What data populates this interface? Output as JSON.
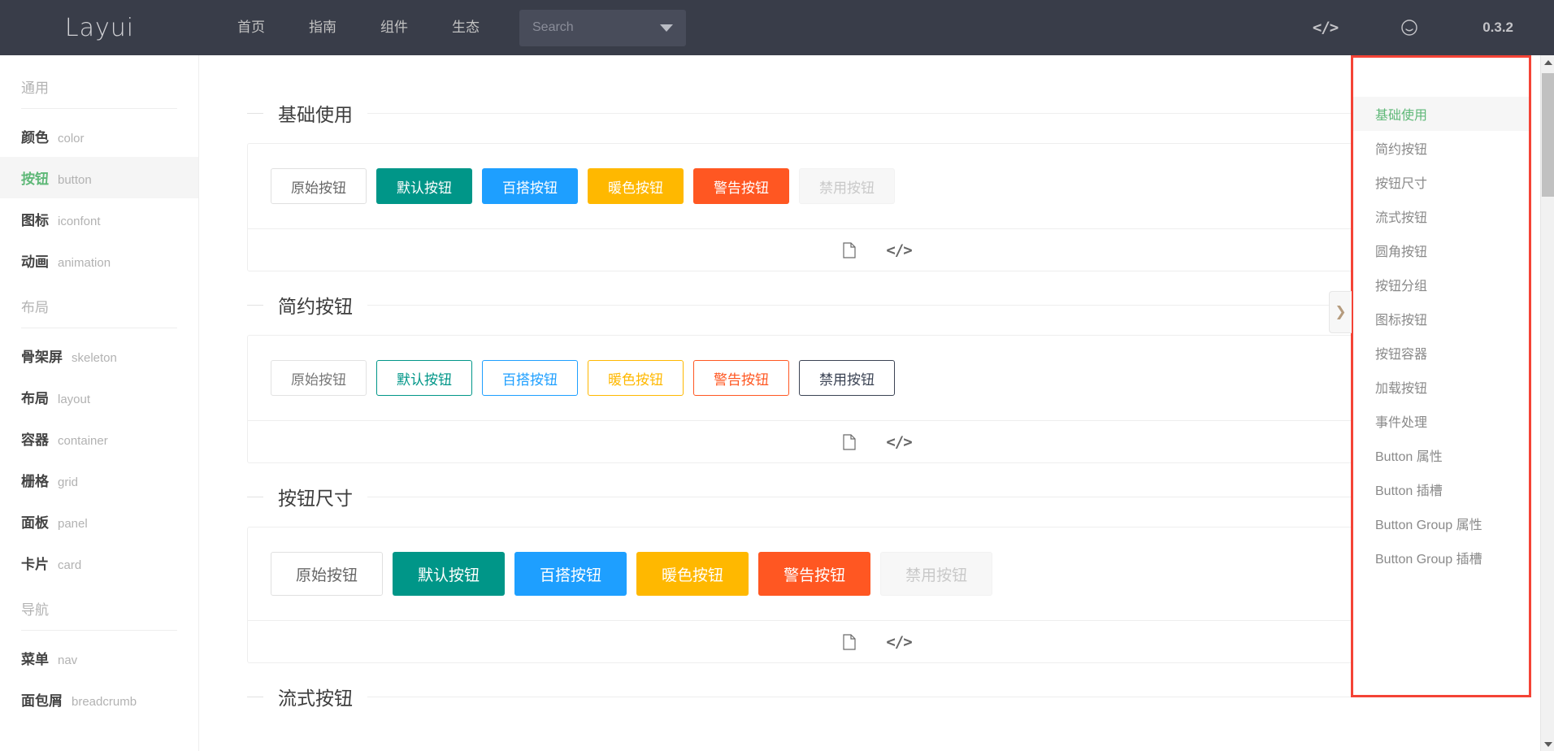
{
  "header": {
    "logo": "Layui",
    "nav": [
      {
        "label": "首页"
      },
      {
        "label": "指南"
      },
      {
        "label": "组件"
      },
      {
        "label": "生态"
      }
    ],
    "search": {
      "value": "",
      "placeholder": "Search"
    },
    "right": {
      "code_icon": "code-icon",
      "smile_icon": "smile-icon",
      "version": "0.3.2"
    }
  },
  "sidebar": {
    "groups": [
      {
        "title": "通用",
        "items": [
          {
            "cn": "颜色",
            "en": "color",
            "active": false
          },
          {
            "cn": "按钮",
            "en": "button",
            "active": true
          },
          {
            "cn": "图标",
            "en": "iconfont",
            "active": false
          },
          {
            "cn": "动画",
            "en": "animation",
            "active": false
          }
        ]
      },
      {
        "title": "布局",
        "items": [
          {
            "cn": "骨架屏",
            "en": "skeleton",
            "active": false
          },
          {
            "cn": "布局",
            "en": "layout",
            "active": false
          },
          {
            "cn": "容器",
            "en": "container",
            "active": false
          },
          {
            "cn": "栅格",
            "en": "grid",
            "active": false
          },
          {
            "cn": "面板",
            "en": "panel",
            "active": false
          },
          {
            "cn": "卡片",
            "en": "card",
            "active": false
          }
        ]
      },
      {
        "title": "导航",
        "items": [
          {
            "cn": "菜单",
            "en": "nav",
            "active": false
          },
          {
            "cn": "面包屑",
            "en": "breadcrumb",
            "active": false
          }
        ]
      }
    ]
  },
  "main": {
    "sections": [
      {
        "title": "基础使用",
        "buttons": [
          {
            "label": "原始按钮",
            "style": "btn-primary-plain"
          },
          {
            "label": "默认按钮",
            "style": "btn-normal"
          },
          {
            "label": "百搭按钮",
            "style": "btn-blue"
          },
          {
            "label": "暖色按钮",
            "style": "btn-warm"
          },
          {
            "label": "警告按钮",
            "style": "btn-danger"
          },
          {
            "label": "禁用按钮",
            "style": "btn-disabled"
          }
        ],
        "foot": [
          {
            "icon": "document-icon"
          },
          {
            "icon": "code-icon"
          }
        ]
      },
      {
        "title": "简约按钮",
        "buttons": [
          {
            "label": "原始按钮",
            "style": "btn-o-primary"
          },
          {
            "label": "默认按钮",
            "style": "btn-o-normal"
          },
          {
            "label": "百搭按钮",
            "style": "btn-o-blue"
          },
          {
            "label": "暖色按钮",
            "style": "btn-o-warm"
          },
          {
            "label": "警告按钮",
            "style": "btn-o-danger"
          },
          {
            "label": "禁用按钮",
            "style": "btn-o-disabled"
          }
        ],
        "foot": [
          {
            "icon": "document-icon"
          },
          {
            "icon": "code-icon"
          }
        ]
      },
      {
        "title": "按钮尺寸",
        "size": "lg",
        "buttons": [
          {
            "label": "原始按钮",
            "style": "btn-primary-plain"
          },
          {
            "label": "默认按钮",
            "style": "btn-normal"
          },
          {
            "label": "百搭按钮",
            "style": "btn-blue"
          },
          {
            "label": "暖色按钮",
            "style": "btn-warm"
          },
          {
            "label": "警告按钮",
            "style": "btn-danger"
          },
          {
            "label": "禁用按钮",
            "style": "btn-disabled"
          }
        ],
        "foot": [
          {
            "icon": "document-icon"
          },
          {
            "icon": "code-icon"
          }
        ]
      },
      {
        "title": "流式按钮",
        "partial": true,
        "buttons": [],
        "foot": []
      }
    ]
  },
  "toc": {
    "highlight_color": "#F44336",
    "items": [
      {
        "label": "基础使用",
        "active": true
      },
      {
        "label": "简约按钮",
        "active": false
      },
      {
        "label": "按钮尺寸",
        "active": false
      },
      {
        "label": "流式按钮",
        "active": false
      },
      {
        "label": "圆角按钮",
        "active": false
      },
      {
        "label": "按钮分组",
        "active": false
      },
      {
        "label": "图标按钮",
        "active": false
      },
      {
        "label": "按钮容器",
        "active": false
      },
      {
        "label": "加载按钮",
        "active": false
      },
      {
        "label": "事件处理",
        "active": false
      },
      {
        "label": "Button 属性",
        "active": false
      },
      {
        "label": "Button 插槽",
        "active": false
      },
      {
        "label": "Button Group 属性",
        "active": false
      },
      {
        "label": "Button Group 插槽",
        "active": false
      }
    ],
    "collapse_handle": "chevron-right-icon"
  }
}
